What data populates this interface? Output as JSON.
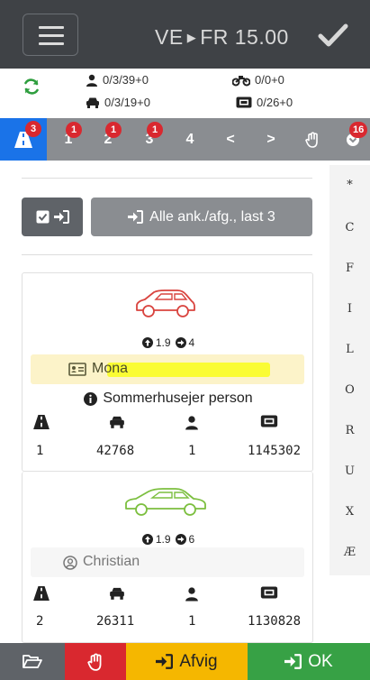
{
  "header": {
    "route_from": "VE",
    "route_to": "FR 15.00"
  },
  "counters": {
    "persons": "0/3/39+0",
    "bikes": "0/0+0",
    "cars": "0/3/19+0",
    "tickets": "0/26+0"
  },
  "tabs": [
    {
      "label": "",
      "badge": "3"
    },
    {
      "label": "1",
      "badge": "1"
    },
    {
      "label": "2",
      "badge": "1"
    },
    {
      "label": "3",
      "badge": "1"
    },
    {
      "label": "4",
      "badge": ""
    },
    {
      "label": "<",
      "badge": ""
    },
    {
      "label": ">",
      "badge": ""
    },
    {
      "label": "",
      "badge": ""
    },
    {
      "label": "",
      "badge": "16"
    }
  ],
  "alphabet": [
    "*",
    "C",
    "F",
    "I",
    "L",
    "O",
    "R",
    "U",
    "X",
    "Æ"
  ],
  "actions": {
    "all_label": "Alle ank./afg., last 3"
  },
  "bookings": [
    {
      "car_color": "#d9443f",
      "length": "1.9",
      "count": "4",
      "name": "Mona",
      "note": "Sommerhusejer person",
      "lane": "1",
      "car_no": "42768",
      "persons": "1",
      "ticket": "1145302"
    },
    {
      "car_color": "#7cbf3f",
      "length": "1.9",
      "count": "6",
      "name": "Christian",
      "note": "",
      "lane": "2",
      "car_no": "26311",
      "persons": "1",
      "ticket": "1130828"
    }
  ],
  "footer": {
    "deviate_label": "Afvig",
    "ok_label": "OK"
  },
  "colors": {
    "header_bg": "#3f4246",
    "tab_active": "#1a73e8",
    "badge": "#d9282f",
    "sync": "#2e9e3e",
    "footer_folder": "#5f6368",
    "footer_stop": "#d9282f",
    "footer_deviate": "#f5b700",
    "footer_ok": "#37a145"
  }
}
